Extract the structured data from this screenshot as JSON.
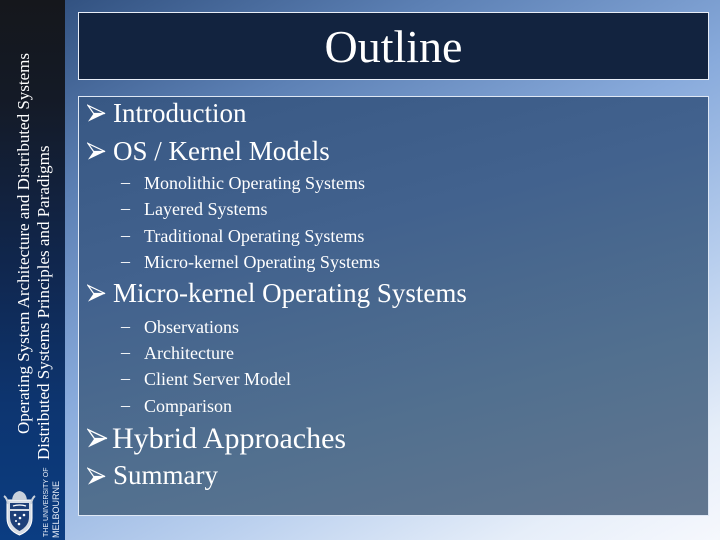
{
  "sidebar": {
    "course_title_line1": "Operating System Architecture and Distributed Systems",
    "course_title_line2": "Distributed Systems Principles and Paradigms",
    "logo": {
      "icon": "university-crest-icon",
      "line1": "THE UNIVERSITY OF",
      "line2": "MELBOURNE"
    }
  },
  "slide": {
    "title": "Outline",
    "bullet_icon": "arrow-bullet-icon",
    "sub_bullet_marker": "–",
    "sections": [
      {
        "label": "Introduction",
        "items": []
      },
      {
        "label": "OS / Kernel Models",
        "items": [
          "Monolithic Operating Systems",
          "Layered Systems",
          "Traditional Operating Systems",
          "Micro-kernel Operating Systems"
        ]
      },
      {
        "label": "Micro-kernel Operating Systems",
        "items": [
          "Observations",
          "Architecture",
          "Client Server Model",
          "Comparison"
        ]
      },
      {
        "label": "Hybrid Approaches",
        "items": []
      },
      {
        "label": "Summary",
        "items": []
      }
    ]
  },
  "colors": {
    "title_background": "#12233f",
    "sidebar_top": "#15171c",
    "sidebar_bottom": "#0b3d82",
    "text": "#ffffff"
  }
}
